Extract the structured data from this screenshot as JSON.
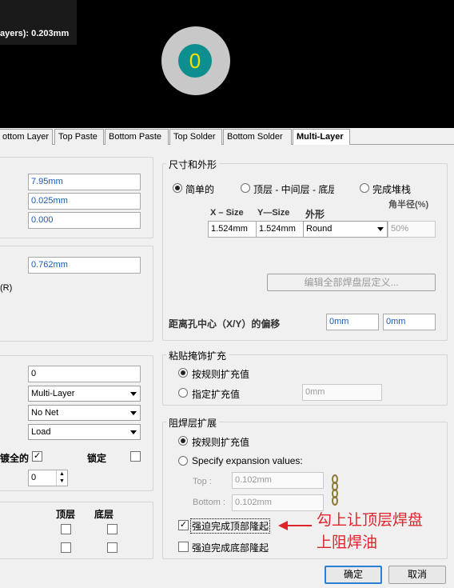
{
  "preview": {
    "layer_readout": "ayers): 0.203mm",
    "pad_number": "0"
  },
  "tabs": [
    "ottom Layer",
    "Top Paste",
    "Bottom Paste",
    "Top Solder",
    "Bottom Solder",
    "Multi-Layer"
  ],
  "left": {
    "hole_fields": [
      "7.95mm",
      "0.025mm",
      "0.000"
    ],
    "tolerance_field": "0.762mm",
    "r_label": "(R)",
    "designator_field": "0",
    "layer_select": "Multi-Layer",
    "net_select": "No Net",
    "elec_select": "Load",
    "plated_label": "镀全的",
    "locked_label": "锁定",
    "jumper_field": "0",
    "top_label": "顶层",
    "bottom_label": "底层"
  },
  "size_shape": {
    "title": "尺寸和外形",
    "simple": "简单的",
    "top_mid_bottom": "顶层 - 中间层 - 底层",
    "full_stack": "完成堆栈",
    "corner_radius": "角半径(%)",
    "xsize_header": "X – Size",
    "ysize_header": "Y—Size",
    "shape_header": "外形",
    "xsize": "1.524mm",
    "ysize": "1.524mm",
    "shape": "Round",
    "corner_value": "50%",
    "edit_btn": "编辑全部焊盘层定义...",
    "offset_label": "距离孔中心（X/Y）的偏移",
    "offset_x": "0mm",
    "offset_y": "0mm"
  },
  "paste": {
    "title": "粘贴掩饰扩充",
    "by_rule": "按规则扩充值",
    "specify": "指定扩充值",
    "value": "0mm"
  },
  "solder": {
    "title": "阻焊层扩展",
    "by_rule": "按规则扩充值",
    "specify": "Specify expansion values:",
    "top_label": "Top :",
    "top_value": "0.102mm",
    "bottom_label": "Bottom :",
    "bottom_value": "0.102mm",
    "force_top": "强迫完成顶部隆起",
    "force_bottom": "强迫完成底部隆起"
  },
  "annotation": {
    "line1": "勾上让顶层焊盘",
    "line2": "上阻焊油",
    "color": "#e0242c"
  },
  "buttons": {
    "ok": "确定",
    "cancel": "取消"
  }
}
